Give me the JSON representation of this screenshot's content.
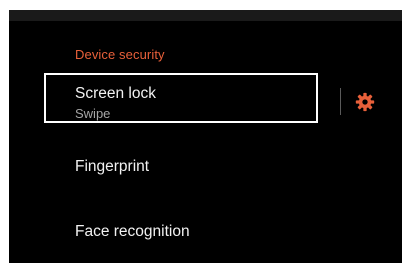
{
  "settings": {
    "section_header": "Device security",
    "items": [
      {
        "label": "Screen lock",
        "sublabel": "Swipe"
      },
      {
        "label": "Fingerprint"
      },
      {
        "label": "Face recognition"
      }
    ]
  },
  "icons": {
    "settings": "gear-icon"
  },
  "colors": {
    "accent": "#e8603a",
    "background": "#000000",
    "text_primary": "#f2f2f2",
    "text_secondary": "#a5a5a5",
    "focus_outline": "#ffffff"
  }
}
